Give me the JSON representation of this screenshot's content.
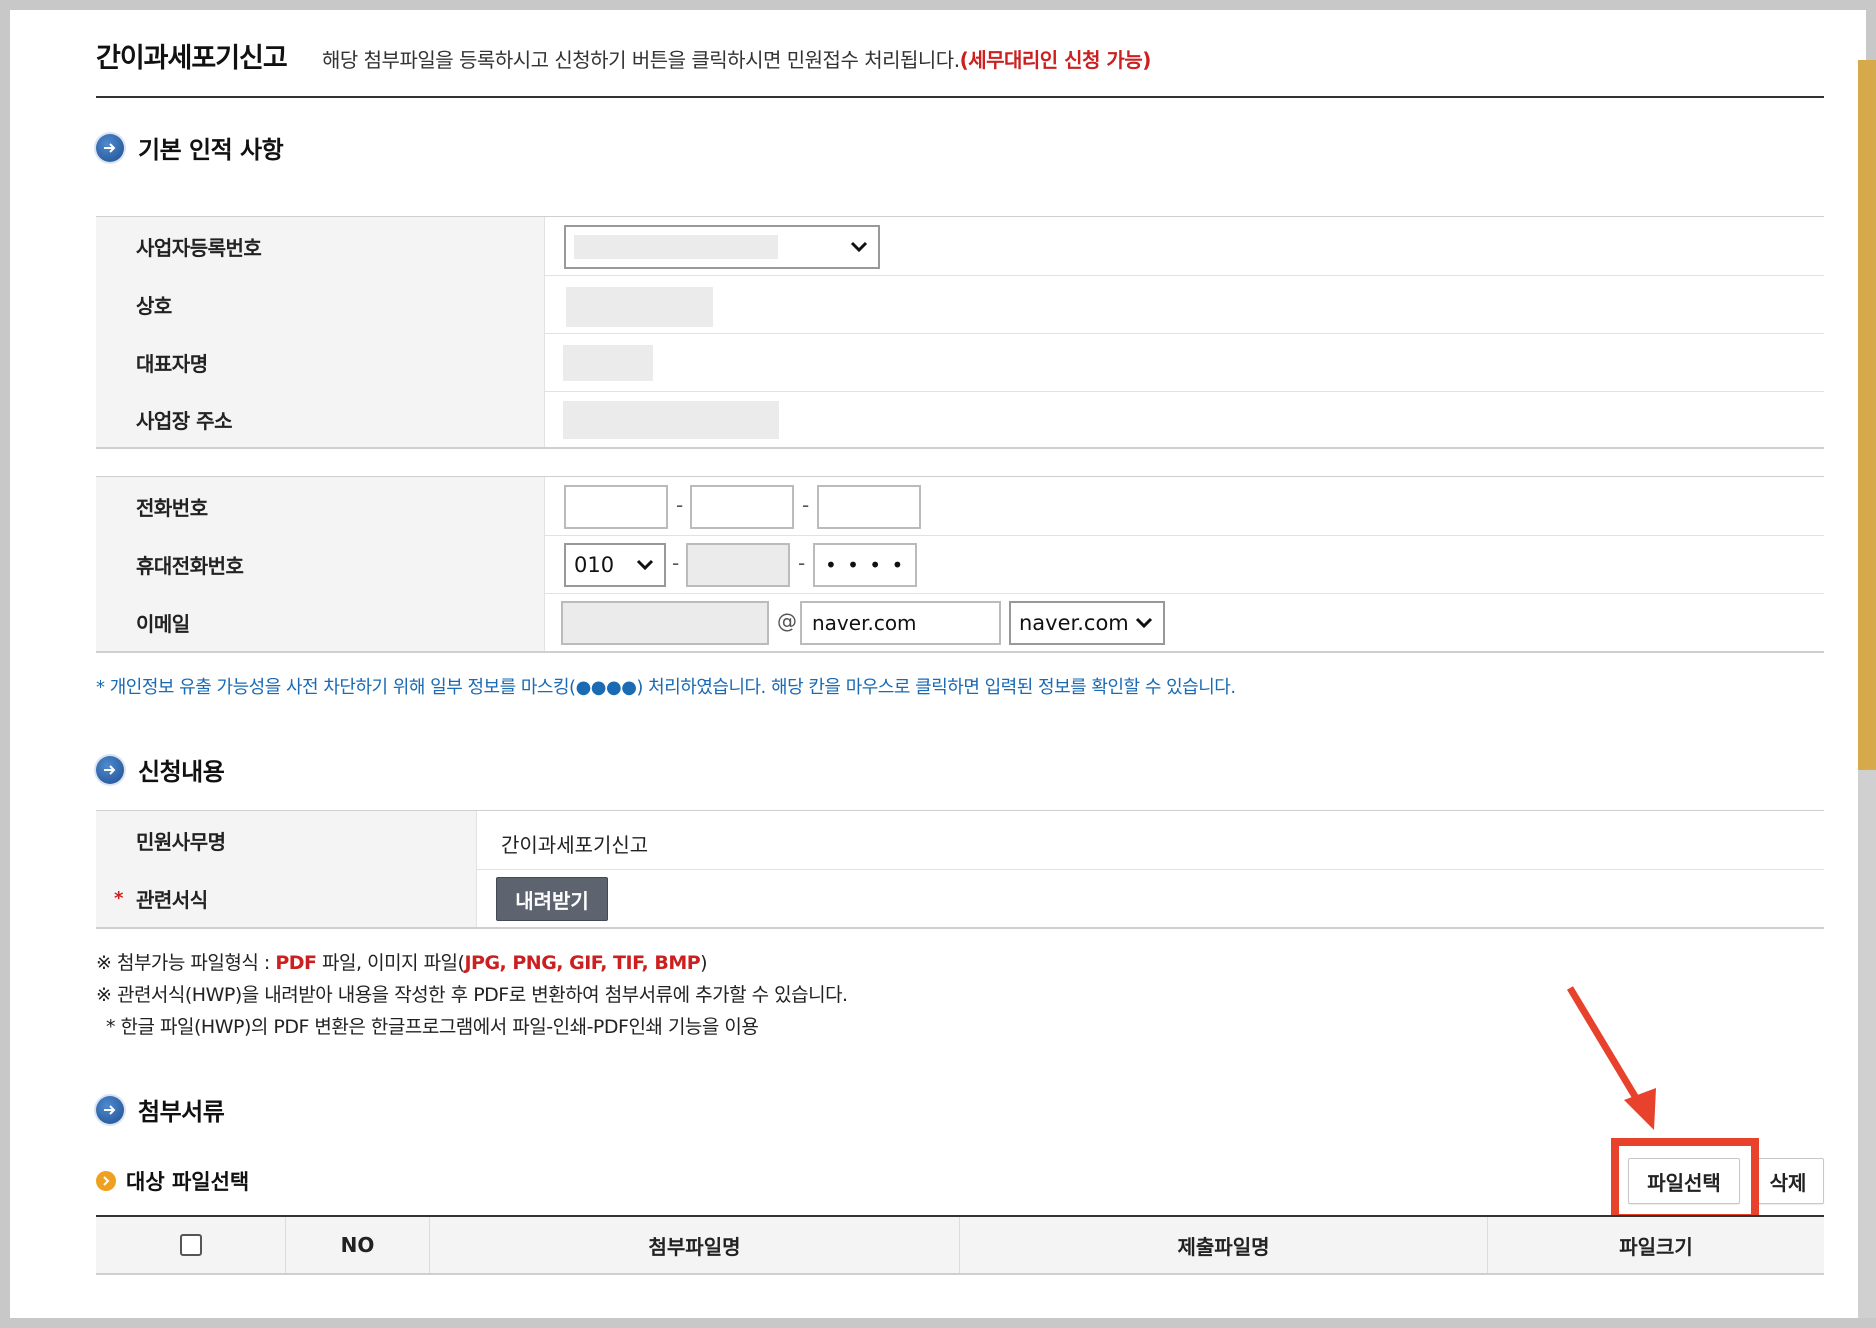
{
  "header": {
    "title": "간이과세포기신고",
    "description": "해당 첨부파일을 등록하시고 신청하기 버튼을 클릭하시면 민원접수 처리됩니다.",
    "description_highlight": "(세무대리인 신청 가능)"
  },
  "basic_info": {
    "title": "기본 인적 사항",
    "rows": {
      "biz_no": "사업자등록번호",
      "company": "상호",
      "representative": "대표자명",
      "address": "사업장 주소"
    },
    "contact": {
      "phone": "전화번호",
      "mobile": "휴대전화번호",
      "mobile_prefix": "010",
      "mobile_last": "• • • •",
      "email": "이메일",
      "email_at": "@",
      "email_domain_value": "naver.com",
      "email_domain_select": "naver.com",
      "dash": "-"
    },
    "notice": "* 개인정보 유출 가능성을 사전 차단하기 위해 일부 정보를 마스킹(●●●●) 처리하였습니다. 해당 칸을 마우스로 클릭하면 입력된 정보를 확인할 수 있습니다."
  },
  "application": {
    "title": "신청내용",
    "service_name_label": "민원사무명",
    "service_name_value": "간이과세포기신고",
    "required_mark": "*",
    "form_label": "관련서식",
    "download_button": "내려받기",
    "notes": {
      "n1_prefix": "※ 첨부가능 파일형식 : ",
      "n1_pdf": "PDF",
      "n1_mid": " 파일, 이미지 파일(",
      "n1_formats": "JPG, PNG, GIF, TIF, BMP",
      "n1_end": ")",
      "n2": "※ 관련서식(HWP)을 내려받아 내용을 작성한 후 PDF로 변환하여 첨부서류에 추가할 수 있습니다.",
      "n3": "* 한글 파일(HWP)의 PDF 변환은 한글프로그램에서 파일-인쇄-PDF인쇄 기능을 이용"
    }
  },
  "attachments": {
    "title": "첨부서류",
    "subtitle": "대상 파일선택",
    "select_file_button": "파일선택",
    "delete_button": "삭제",
    "columns": [
      "NO",
      "첨부파일명",
      "제출파일명",
      "파일크기"
    ]
  },
  "colors": {
    "accent_red": "#cc1f1f",
    "notice_blue": "#1a6ab4",
    "highlight_red": "#e8412c"
  }
}
